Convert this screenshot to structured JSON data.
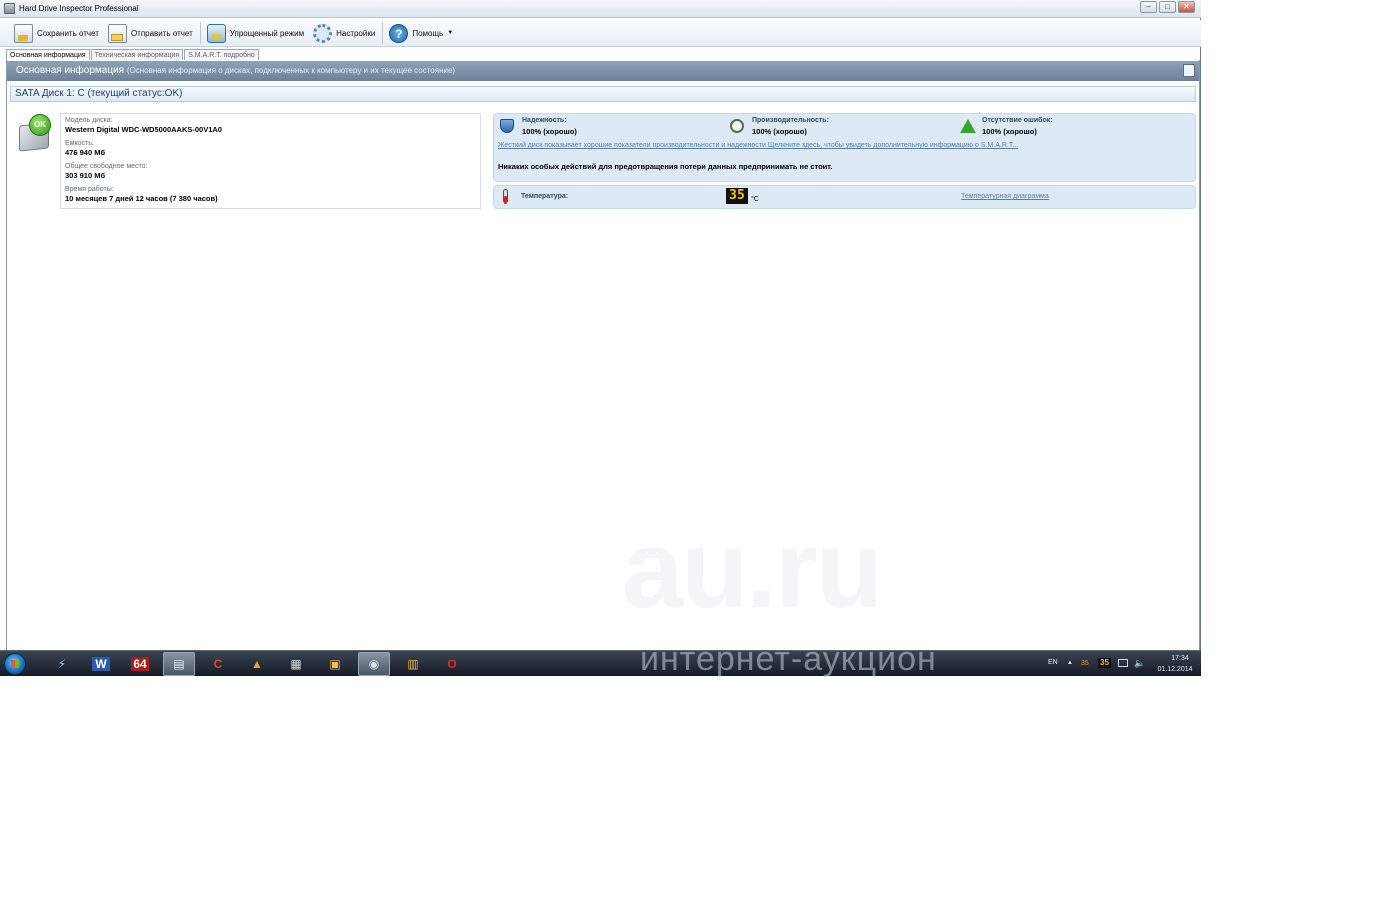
{
  "window": {
    "title": "Hard Drive Inspector Professional"
  },
  "toolbar": {
    "save_label": "Сохранить отчет",
    "send_label": "Отправить отчет",
    "simple_label": "Упрощенный режим",
    "settings_label": "Настройки",
    "help_label": "Помощь"
  },
  "tabs": [
    {
      "label": "Основная информация"
    },
    {
      "label": "Техническая информация"
    },
    {
      "label": "S.M.A.R.T. подробно"
    }
  ],
  "section": {
    "title": "Основная информация",
    "subtitle": "(Основная информация о дисках, подключенных к компьютеру и  их текущее состояние)"
  },
  "disk": {
    "header": "SATA Диск 1: C (текущий статус:OK)",
    "status_badge": "OK",
    "model_label": "Модель диска:",
    "model_value": "Western Digital WDC-WD5000AAKS-00V1A0",
    "capacity_label": "Емкость:",
    "capacity_value": "476 940 Мб",
    "free_label": "Общее свободное место:",
    "free_value": "303 910 Мб",
    "uptime_label": "Время работы:",
    "uptime_value": "10 месяцев 7 дней 12 часов (7 380 часов)"
  },
  "status": {
    "reliability_label": "Надежность:",
    "reliability_value": "100% (хорошо)",
    "performance_label": "Производительность:",
    "performance_value": "100% (хорошо)",
    "errors_label": "Отсутствие ошибок:",
    "errors_value": "100% (хорошо)",
    "link_text": "Жесткий диск показывает хорошие показатели производительности и надежности Щелкните здесь, чтобы увидеть дополнительную информацию о S.M.A.R.T...",
    "note": "Никаких особых действий для предотвращения потери данных предпринимать не стоит."
  },
  "temperature": {
    "label": "Температура:",
    "value": "35",
    "unit": "°C",
    "chart_link": "Температурная диаграмма"
  },
  "taskbar": {
    "apps": [
      "Lightning",
      "Word",
      "AIDA64",
      "Hard Drive Inspector",
      "CCleaner",
      "AIMP",
      "Media Player Classic",
      "Explorer",
      "Chrome",
      "WinRAR",
      "Opera"
    ],
    "app_64_label": "64",
    "app_word_label": "W",
    "tray": {
      "lang": "EN",
      "temp_small": "35",
      "temp_display": "35",
      "time": "17:34",
      "date": "01.12.2014"
    }
  },
  "watermark": {
    "big": "au.ru",
    "text": "интернет-аукцион"
  },
  "colors": {
    "header_bg": "#7b90a6",
    "panel_bg": "#dde9f5",
    "link": "#5a7db0",
    "ok_green": "#2f9a13",
    "temp_digits": "#f2c400"
  }
}
